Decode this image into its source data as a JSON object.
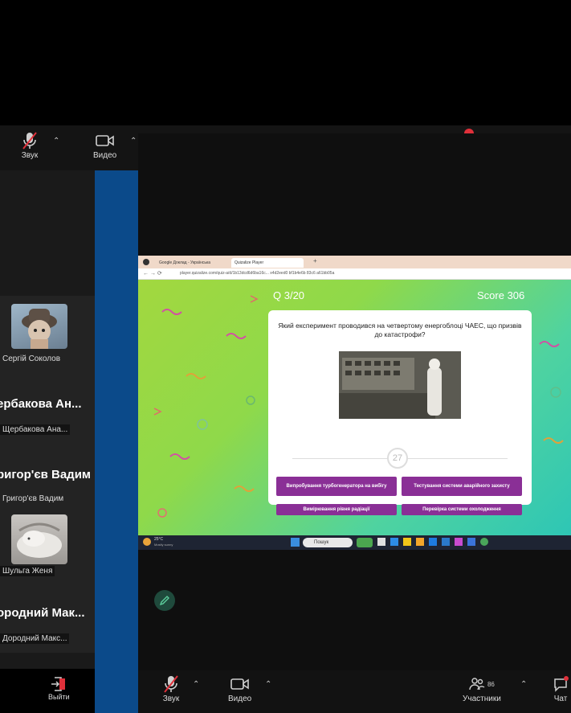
{
  "top_toolbar": {
    "audio_label": "Звук",
    "video_label": "Видео"
  },
  "gallery": {
    "participants": [
      {
        "display_name": "Сергій Соколов"
      },
      {
        "big_name": "ербакова Ан...",
        "display_name": "Щербакова Ана..."
      },
      {
        "big_name": "ригор'єв Вадим",
        "display_name": "Григор'єв Вадим"
      },
      {
        "display_name": "Шульга Женя"
      },
      {
        "big_name": "ородний Мак...",
        "display_name": "Дородний Макс..."
      }
    ],
    "leave_label": "Выйти"
  },
  "browser": {
    "tabs": [
      "Google Доклад - Українська",
      "Quizalize Player"
    ],
    "url": "player.quizalize.com/quiz-a/d/1b13dcd6d6ba16c...   x4d2eed0 bf1b4e6b 83c6 a61bb05a"
  },
  "quiz": {
    "counter": "Q 3/20",
    "score": "Score 306",
    "question": "Який експеримент проводився на четвертому енергоблоці ЧАЕС, що призвів до катастрофи?",
    "timer": "27",
    "answers": [
      "Випробування турбогенератора на вибігу",
      "Тестування системи аварійного захисту",
      "Вимірювання рівня радіації",
      "Перевірка системи охолодження"
    ]
  },
  "taskbar": {
    "weather": "25°C",
    "weather_sub": "Mostly sunny",
    "search_placeholder": "Пошук"
  },
  "bottom_toolbar": {
    "audio_label": "Звук",
    "video_label": "Видео",
    "participants_label": "Участники",
    "participants_count": "86",
    "chat_label": "Чат"
  },
  "colors": {
    "answer_purple": "#8a2f96",
    "blue_strip": "#0b4a8a",
    "mute_red": "#e0303a"
  }
}
